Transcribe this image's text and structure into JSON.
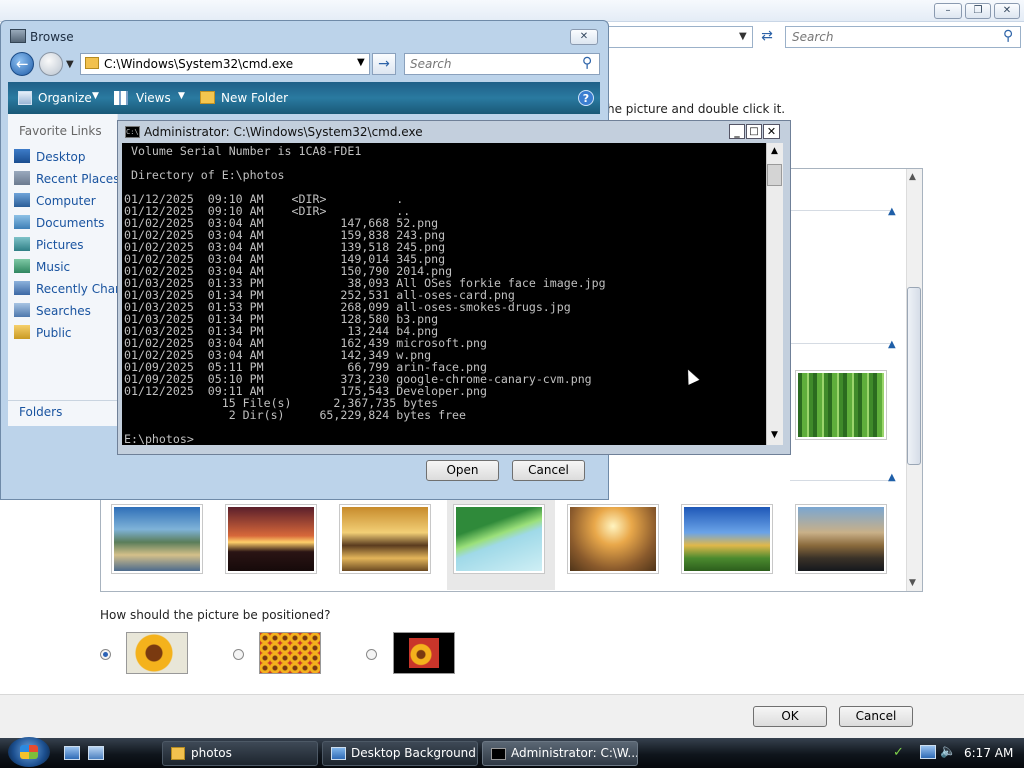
{
  "background_window": {
    "search_placeholder": "Search",
    "hint": "he picture and double click it.",
    "position_question": "How should the picture be positioned?",
    "ok": "OK",
    "cancel": "Cancel",
    "win_buttons": [
      "minimize-icon",
      "maximize-icon",
      "close-icon"
    ]
  },
  "browse": {
    "title": "Browse",
    "address": "C:\\Windows\\System32\\cmd.exe",
    "search_placeholder": "Search",
    "toolbar": {
      "organize": "Organize",
      "views": "Views",
      "new_folder": "New Folder"
    },
    "favorite_links_header": "Favorite Links",
    "links": [
      "Desktop",
      "Recent Places",
      "Computer",
      "Documents",
      "Pictures",
      "Music",
      "Recently Chan",
      "Searches",
      "Public"
    ],
    "folders": "Folders",
    "open": "Open",
    "cancel": "Cancel"
  },
  "cmd": {
    "title": "Administrator: C:\\Windows\\System32\\cmd.exe",
    "lines": [
      " Volume Serial Number is 1CA8-FDE1",
      "",
      " Directory of E:\\photos",
      "",
      "01/12/2025  09:10 AM    <DIR>          .",
      "01/12/2025  09:10 AM    <DIR>          ..",
      "01/02/2025  03:04 AM           147,668 52.png",
      "01/02/2025  03:04 AM           159,838 243.png",
      "01/02/2025  03:04 AM           139,518 245.png",
      "01/02/2025  03:04 AM           149,014 345.png",
      "01/02/2025  03:04 AM           150,790 2014.png",
      "01/03/2025  01:33 PM            38,093 All OSes forkie face image.jpg",
      "01/03/2025  01:34 PM           252,531 all-oses-card.png",
      "01/03/2025  01:53 PM           268,099 all-oses-smokes-drugs.jpg",
      "01/03/2025  01:34 PM           128,580 b3.png",
      "01/03/2025  01:34 PM            13,244 b4.png",
      "01/02/2025  03:04 AM           162,439 microsoft.png",
      "01/02/2025  03:04 AM           142,349 w.png",
      "01/09/2025  05:11 PM            66,799 arin-face.png",
      "01/09/2025  05:10 PM           373,230 google-chrome-canary-cvm.png",
      "01/12/2025  09:11 AM           175,543 Developer.png",
      "              15 File(s)      2,367,735 bytes",
      "               2 Dir(s)     65,229,824 bytes free",
      "",
      "E:\\photos>"
    ]
  },
  "taskbar": {
    "items": [
      "photos",
      "Desktop Background",
      "Administrator: C:\\W..."
    ],
    "clock": "6:17 AM"
  }
}
